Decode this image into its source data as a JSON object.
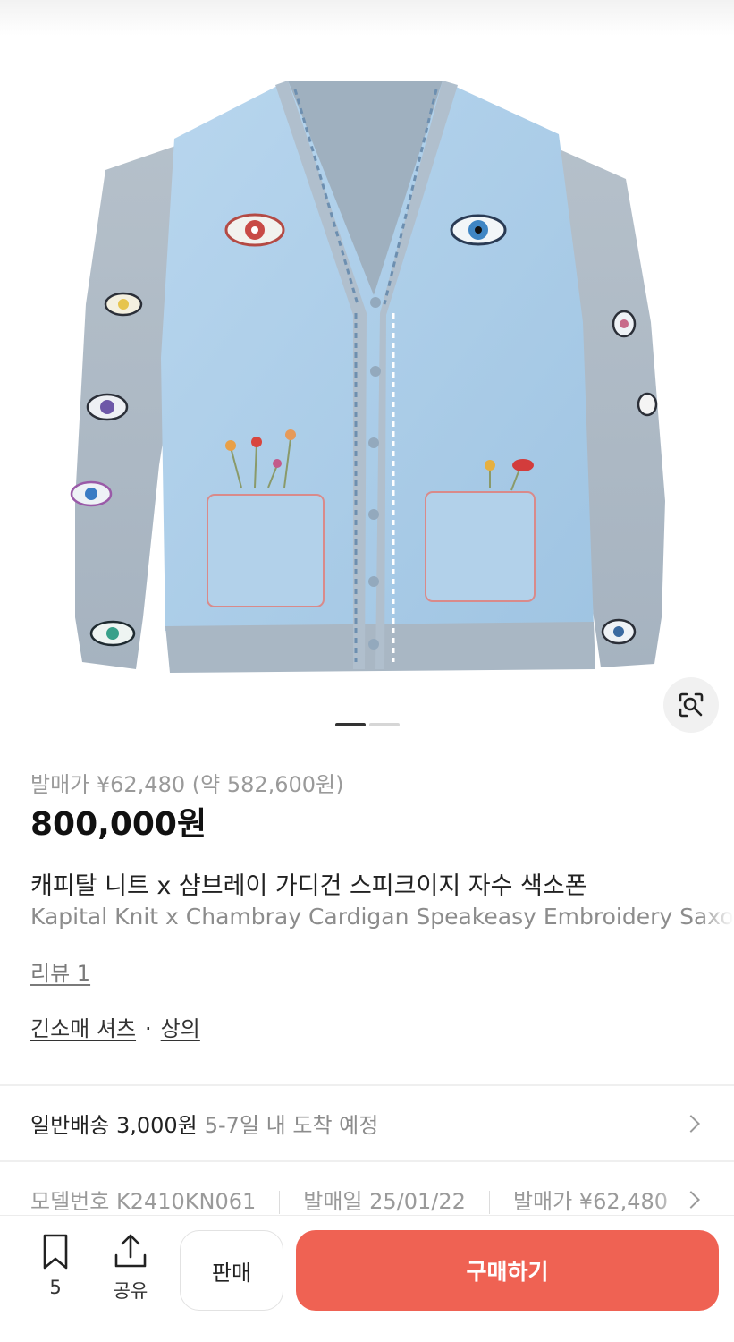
{
  "gallery": {
    "total_images": 2,
    "active_index": 1,
    "image_icon": "embroidered-cardigan-photo",
    "lens_icon": "image-search-icon"
  },
  "product": {
    "release_line": "발매가 ¥62,480 (약 582,600원)",
    "price": "800,000원",
    "title_ko": "캐피탈 니트 x 샴브레이 가디건 스피크이지 자수 색소폰",
    "title_en": "Kapital Knit x Chambray Cardigan Speakeasy Embroidery Saxophone",
    "reviews": "리뷰 1",
    "category_1": "긴소매 셔츠",
    "category_sep": "·",
    "category_2": "상의"
  },
  "shipping": {
    "label": "일반배송 3,000원",
    "eta": "5-7일 내 도착 예정"
  },
  "specs": {
    "model": "모델번호 K2410KN061",
    "release_date": "발매일 25/01/22",
    "release_price": "발매가 ¥62,480"
  },
  "bottom_bar": {
    "bookmark_count": "5",
    "share_label": "공유",
    "sell_label": "판매",
    "buy_label": "구매하기"
  },
  "colors": {
    "buy_button": "#ef6253",
    "cardigan_body": "#a9cbe6",
    "cardigan_sleeve": "#aab6c2"
  }
}
